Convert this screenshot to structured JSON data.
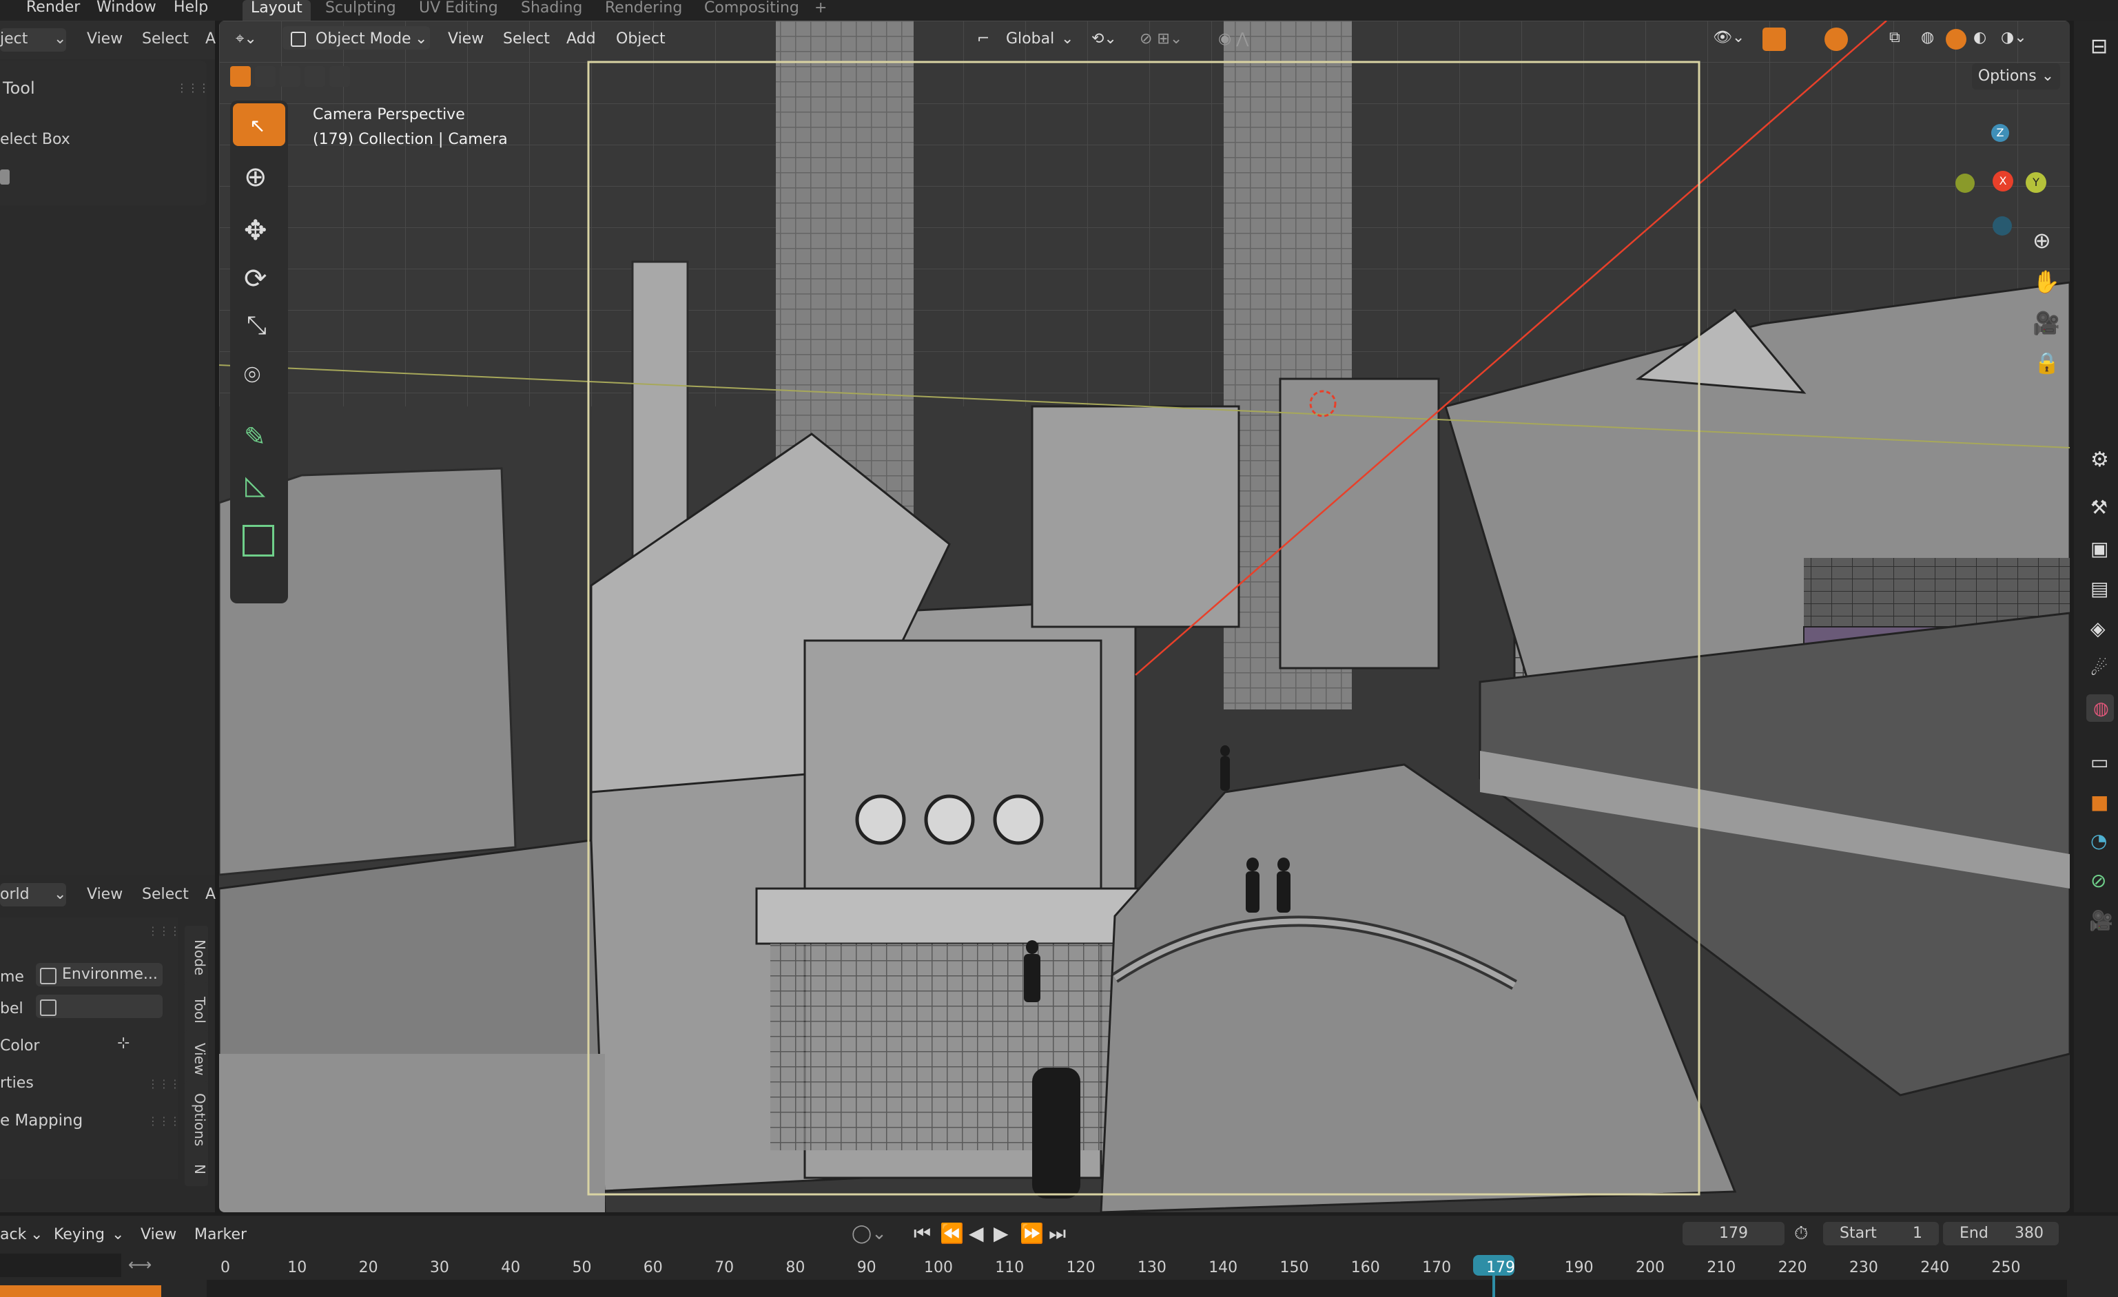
{
  "top_menu": {
    "items": [
      "Render",
      "Window",
      "Help"
    ]
  },
  "workspaces": {
    "tabs": [
      "Layout",
      "Sculpting",
      "UV Editing",
      "Shading",
      "Rendering",
      "Compositing"
    ],
    "add": "+"
  },
  "left_panel": {
    "header_mode": "ject",
    "header_view": "View",
    "header_select": "Select",
    "header_a": "A",
    "tool_title": "Tool",
    "select_box": "elect Box"
  },
  "world_panel": {
    "header_mode": "orld",
    "header_view": "View",
    "header_select": "Select",
    "header_a": "A",
    "name_label": "me",
    "name_value": "Environme...",
    "label_label": "bel",
    "color_label": "Color",
    "properties_label": "rties",
    "mapping_label": "e Mapping",
    "side_tabs": [
      "Node",
      "Tool",
      "View",
      "Options",
      "N"
    ]
  },
  "viewport": {
    "mode": "Object Mode",
    "menu": [
      "View",
      "Select",
      "Add",
      "Object"
    ],
    "transform": "Global",
    "options": "Options",
    "overlay_title": "Camera Perspective",
    "overlay_subtitle": "(179) Collection | Camera",
    "gizmo": {
      "z": "Z",
      "x": "X",
      "y": "Y"
    }
  },
  "timeline": {
    "mode": "ack",
    "keying": "Keying",
    "view": "View",
    "marker": "Marker",
    "current_frame": "179",
    "start_label": "Start",
    "start_value": "1",
    "end_label": "End",
    "end_value": "380",
    "ticks": [
      "0",
      "10",
      "20",
      "30",
      "40",
      "50",
      "60",
      "70",
      "80",
      "90",
      "100",
      "110",
      "120",
      "130",
      "140",
      "150",
      "160",
      "170",
      "179",
      "190",
      "200",
      "210",
      "220",
      "230",
      "240",
      "250"
    ]
  },
  "colors": {
    "accent": "#e07a1f",
    "playhead": "#2e8ea6",
    "axis_x": "#e8402a",
    "axis_y": "#b5c23a",
    "axis_z": "#3f8fb8",
    "camera_frame": "#d9d3a3"
  },
  "icons": [
    "select-box-icon",
    "cursor-icon",
    "move-icon",
    "rotate-icon",
    "scale-icon",
    "transform-icon",
    "annotate-icon",
    "measure-icon",
    "add-cube-icon",
    "zoom-icon",
    "hand-icon",
    "camera-icon",
    "lock-icon"
  ]
}
